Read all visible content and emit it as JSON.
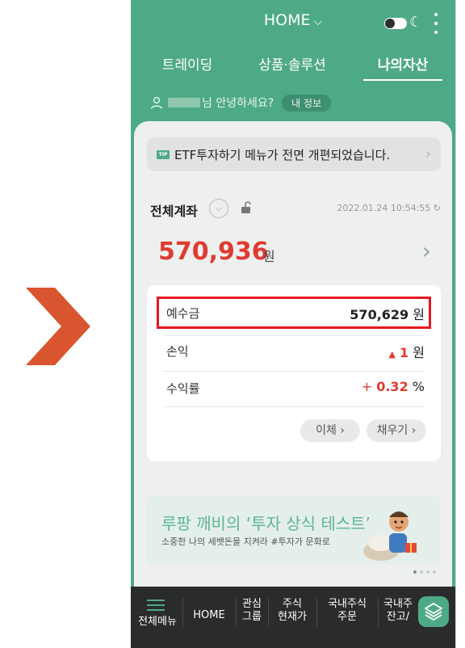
{
  "header": {
    "title": "HOME",
    "title_chevron": "⌵"
  },
  "tabs": [
    "트레이딩",
    "상품·솔루션",
    "나의자산"
  ],
  "greeting": {
    "suffix": "님 안녕하세요?",
    "info_button": "내 정보"
  },
  "tip": {
    "badge": "TIP",
    "text": "ETF투자하기 메뉴가 전면 개편되었습니다."
  },
  "account": {
    "title": "전체계좌",
    "timestamp": "2022.01.24 10:54:55",
    "total": "570,936",
    "total_unit": "원"
  },
  "details": {
    "deposit": {
      "label": "예수금",
      "value": "570,629",
      "unit": "원"
    },
    "profit": {
      "label": "손익",
      "prefix": "▲",
      "value": "1",
      "unit": "원"
    },
    "rate": {
      "label": "수익률",
      "prefix": "+",
      "value": "0.32",
      "unit": "%"
    },
    "buttons": [
      "이체 ›",
      "채우기 ›"
    ]
  },
  "banner": {
    "title": "루팡 깨비의 ‘투자 상식 테스트’",
    "subtitle": "소중한 나의 세뱃돈을 지켜라 #투자가 문화로"
  },
  "bottom_nav": {
    "items": [
      "전체메뉴",
      "HOME",
      "관심\n그룹",
      "주식\n현재가",
      "국내주식\n주문",
      "국내주\n잔고/"
    ]
  },
  "colors": {
    "brand_green": "#4eaa86",
    "accent_red": "#e03b30",
    "highlight_red": "#e8161f",
    "arrow_orange": "#d9552f"
  }
}
